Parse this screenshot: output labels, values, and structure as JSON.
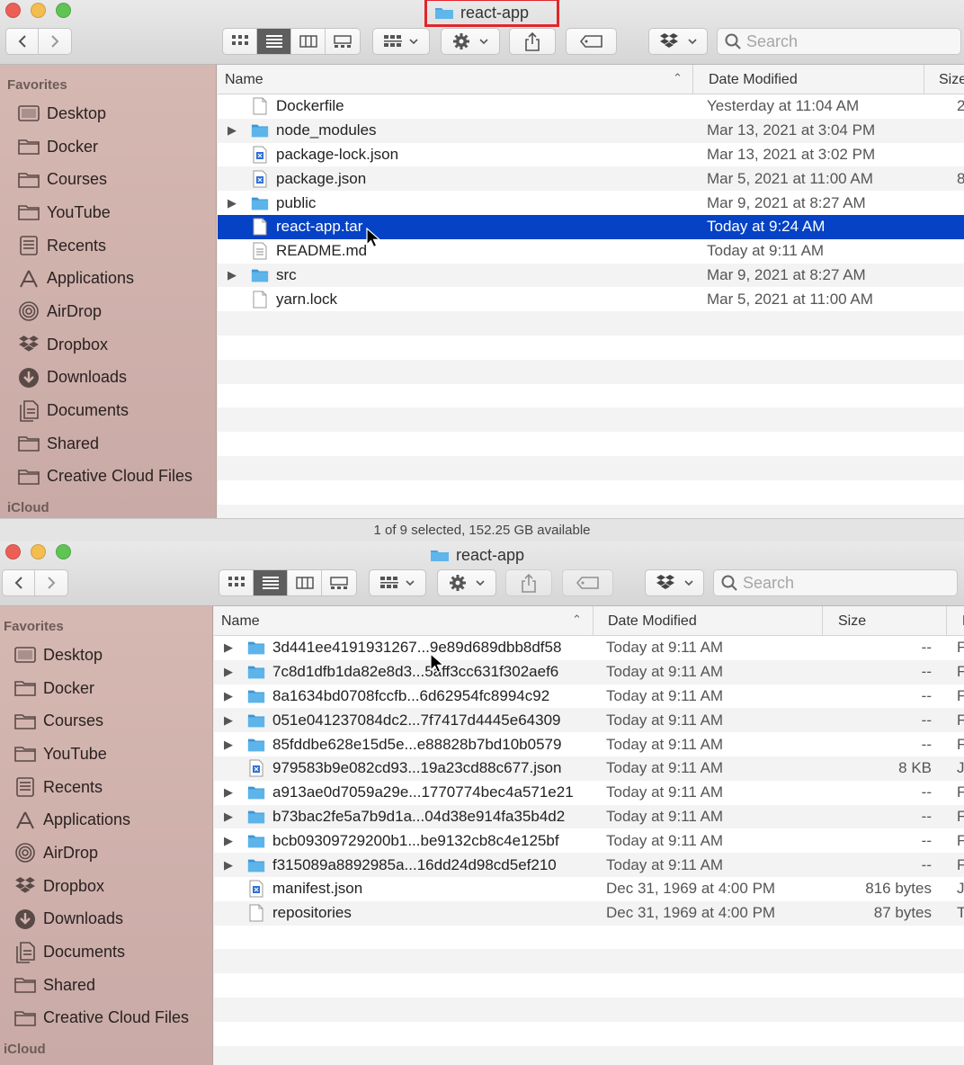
{
  "window_top": {
    "title": "react-app",
    "search_placeholder": "Search",
    "columns": {
      "name": "Name",
      "date": "Date Modified",
      "size": "Size"
    },
    "sidebar": {
      "favorites_label": "Favorites",
      "items": [
        {
          "label": "Desktop",
          "icon": "desktop-icon"
        },
        {
          "label": "Docker",
          "icon": "folder-icon"
        },
        {
          "label": "Courses",
          "icon": "folder-icon"
        },
        {
          "label": "YouTube",
          "icon": "folder-icon"
        },
        {
          "label": "Recents",
          "icon": "recents-icon"
        },
        {
          "label": "Applications",
          "icon": "applications-icon"
        },
        {
          "label": "AirDrop",
          "icon": "airdrop-icon"
        },
        {
          "label": "Dropbox",
          "icon": "dropbox-icon"
        },
        {
          "label": "Downloads",
          "icon": "downloads-icon"
        },
        {
          "label": "Documents",
          "icon": "documents-icon"
        },
        {
          "label": "Shared",
          "icon": "folder-icon"
        },
        {
          "label": "Creative Cloud Files",
          "icon": "folder-icon"
        }
      ],
      "icloud_label": "iCloud"
    },
    "files": [
      {
        "name": "Dockerfile",
        "date": "Yesterday at 11:04 AM",
        "size": "2",
        "type": "doc"
      },
      {
        "name": "node_modules",
        "date": "Mar 13, 2021 at 3:04 PM",
        "size": "",
        "type": "folder"
      },
      {
        "name": "package-lock.json",
        "date": "Mar 13, 2021 at 3:02 PM",
        "size": "",
        "type": "json"
      },
      {
        "name": "package.json",
        "date": "Mar 5, 2021 at 11:00 AM",
        "size": "8",
        "type": "json"
      },
      {
        "name": "public",
        "date": "Mar 9, 2021 at 8:27 AM",
        "size": "",
        "type": "folder"
      },
      {
        "name": "react-app.tar",
        "date": "Today at 9:24 AM",
        "size": "",
        "type": "doc",
        "selected": true
      },
      {
        "name": "README.md",
        "date": "Today at 9:11 AM",
        "size": "",
        "type": "text"
      },
      {
        "name": "src",
        "date": "Mar 9, 2021 at 8:27 AM",
        "size": "",
        "type": "folder"
      },
      {
        "name": "yarn.lock",
        "date": "Mar 5, 2021 at 11:00 AM",
        "size": "",
        "type": "doc"
      }
    ],
    "status": "1 of 9 selected, 152.25 GB available"
  },
  "window_bottom": {
    "title": "react-app",
    "search_placeholder": "Search",
    "columns": {
      "name": "Name",
      "date": "Date Modified",
      "size": "Size",
      "kind": "K"
    },
    "sidebar": {
      "favorites_label": "Favorites",
      "items": [
        {
          "label": "Desktop",
          "icon": "desktop-icon"
        },
        {
          "label": "Docker",
          "icon": "folder-icon"
        },
        {
          "label": "Courses",
          "icon": "folder-icon"
        },
        {
          "label": "YouTube",
          "icon": "folder-icon"
        },
        {
          "label": "Recents",
          "icon": "recents-icon"
        },
        {
          "label": "Applications",
          "icon": "applications-icon"
        },
        {
          "label": "AirDrop",
          "icon": "airdrop-icon"
        },
        {
          "label": "Dropbox",
          "icon": "dropbox-icon"
        },
        {
          "label": "Downloads",
          "icon": "downloads-icon"
        },
        {
          "label": "Documents",
          "icon": "documents-icon"
        },
        {
          "label": "Shared",
          "icon": "folder-icon"
        },
        {
          "label": "Creative Cloud Files",
          "icon": "folder-icon"
        }
      ],
      "icloud_label": "iCloud"
    },
    "files": [
      {
        "name": "3d441ee4191931267...9e89d689dbb8df58",
        "date": "Today at 9:11 AM",
        "size": "--",
        "kind": "F",
        "type": "folder"
      },
      {
        "name": "7c8d1dfb1da82e8d3...5aff3cc631f302aef6",
        "date": "Today at 9:11 AM",
        "size": "--",
        "kind": "F",
        "type": "folder"
      },
      {
        "name": "8a1634bd0708fccfb...6d62954fc8994c92",
        "date": "Today at 9:11 AM",
        "size": "--",
        "kind": "F",
        "type": "folder"
      },
      {
        "name": "051e041237084dc2...7f7417d4445e64309",
        "date": "Today at 9:11 AM",
        "size": "--",
        "kind": "F",
        "type": "folder"
      },
      {
        "name": "85fddbe628e15d5e...e88828b7bd10b0579",
        "date": "Today at 9:11 AM",
        "size": "--",
        "kind": "F",
        "type": "folder"
      },
      {
        "name": "979583b9e082cd93...19a23cd88c677.json",
        "date": "Today at 9:11 AM",
        "size": "8 KB",
        "kind": "J",
        "type": "json"
      },
      {
        "name": "a913ae0d7059a29e...1770774bec4a571e21",
        "date": "Today at 9:11 AM",
        "size": "--",
        "kind": "F",
        "type": "folder"
      },
      {
        "name": "b73bac2fe5a7b9d1a...04d38e914fa35b4d2",
        "date": "Today at 9:11 AM",
        "size": "--",
        "kind": "F",
        "type": "folder"
      },
      {
        "name": "bcb09309729200b1...be9132cb8c4e125bf",
        "date": "Today at 9:11 AM",
        "size": "--",
        "kind": "F",
        "type": "folder"
      },
      {
        "name": "f315089a8892985a...16dd24d98cd5ef210",
        "date": "Today at 9:11 AM",
        "size": "--",
        "kind": "F",
        "type": "folder"
      },
      {
        "name": "manifest.json",
        "date": "Dec 31, 1969 at 4:00 PM",
        "size": "816 bytes",
        "kind": "J",
        "type": "json"
      },
      {
        "name": "repositories",
        "date": "Dec 31, 1969 at 4:00 PM",
        "size": "87 bytes",
        "kind": "T",
        "type": "doc"
      }
    ]
  },
  "colors": {
    "selection": "#0542c5",
    "folder": "#4aa3df",
    "highlight_box": "#e0262b"
  }
}
